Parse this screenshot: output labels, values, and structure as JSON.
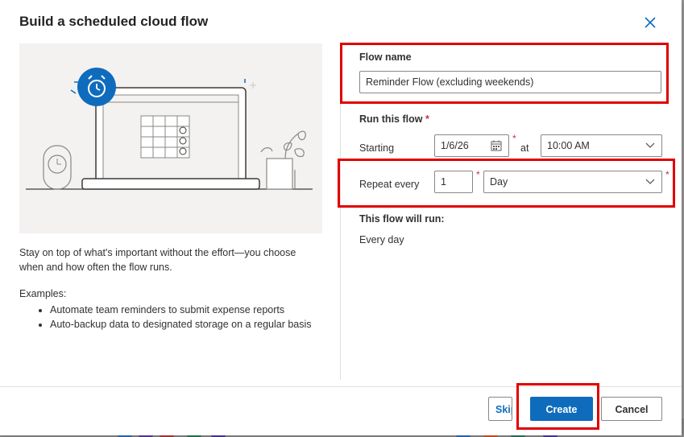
{
  "dialog": {
    "title": "Build a scheduled cloud flow",
    "description": "Stay on top of what's important without the effort—you choose when and how often the flow runs.",
    "examples_title": "Examples:",
    "examples": [
      "Automate team reminders to submit expense reports",
      "Auto-backup data to designated storage on a regular basis"
    ]
  },
  "form": {
    "flow_name_label": "Flow name",
    "flow_name_value": "Reminder Flow (excluding weekends)",
    "run_label": "Run this flow",
    "required_mark": "*",
    "starting_label": "Starting",
    "start_date": "1/6/26",
    "at_label": "at",
    "start_time": "10:00 AM",
    "repeat_label": "Repeat every",
    "repeat_interval": "1",
    "repeat_unit": "Day",
    "summary_label": "This flow will run:",
    "summary_value": "Every day"
  },
  "footer": {
    "skip_label": "Skip",
    "create_label": "Create",
    "cancel_label": "Cancel"
  },
  "colors": {
    "primary": "#0f6cbd",
    "highlight": "#e00000",
    "required": "#c4314b"
  }
}
